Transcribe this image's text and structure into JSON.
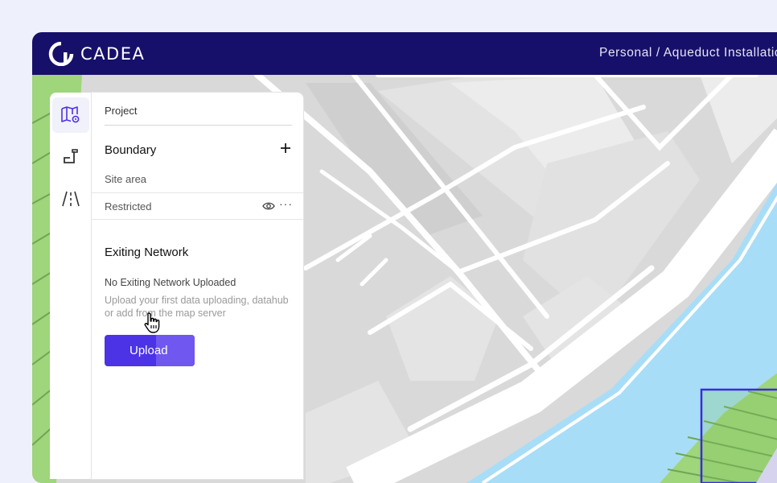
{
  "app": {
    "brand": "CADEA",
    "breadcrumb": "Personal / Aqueduct Installation"
  },
  "rail": {
    "items": [
      {
        "icon": "map-pin-icon",
        "active": true
      },
      {
        "icon": "pipe-icon",
        "active": false
      },
      {
        "icon": "road-icon",
        "active": false
      }
    ]
  },
  "panel": {
    "project_label": "Project",
    "boundary_title": "Boundary",
    "site_area_label": "Site area",
    "restricted_label": "Restricted",
    "more_glyph": "···",
    "exiting_title": "Exiting Network",
    "no_network": "No Exiting Network Uploaded",
    "description": "Upload your first data uploading, datahub or add from the map server",
    "upload_label": "Upload"
  },
  "colors": {
    "topbar": "#17106a",
    "accent": "#4c33e6",
    "water": "#a8ddf7",
    "park": "#9fd57b",
    "road": "#ffffff",
    "block": "#d8d8d8"
  }
}
